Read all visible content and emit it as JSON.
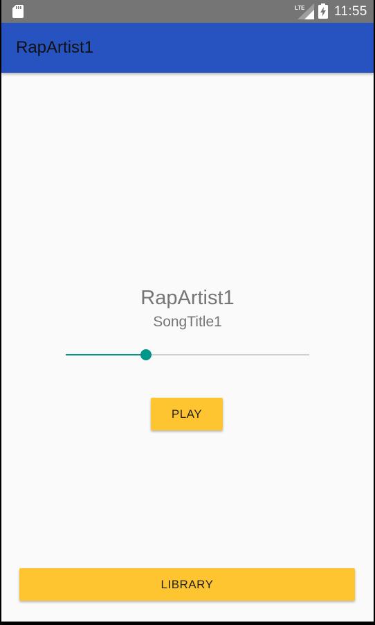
{
  "status_bar": {
    "network_label": "LTE",
    "time": "11:55",
    "icons": [
      "sd-card-icon",
      "lte-signal-icon",
      "battery-charging-icon"
    ]
  },
  "app_bar": {
    "title": "RapArtist1",
    "color": "#2753c0"
  },
  "player": {
    "artist": "RapArtist1",
    "song_title": "SongTitle1",
    "seek_progress": 0.33,
    "seek_color": "#009688",
    "play_label": "PLAY"
  },
  "footer": {
    "library_label": "LIBRARY"
  },
  "colors": {
    "button": "#ffc530",
    "background": "#fafafa",
    "status_bar": "#757575"
  }
}
